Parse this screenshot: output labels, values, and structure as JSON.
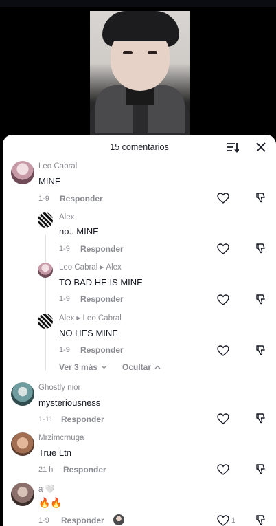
{
  "sheet": {
    "title": "15 comentarios"
  },
  "comments": [
    {
      "user": "Leo Cabral",
      "text": "MINE",
      "date": "1-9",
      "reply_label": "Responder",
      "avatar_color": "#c7a9b4"
    },
    {
      "user": "Alex",
      "text": "no.. MINE",
      "date": "1-9",
      "reply_label": "Responder",
      "avatar_color": "#2a2a2a"
    },
    {
      "user": "Leo Cabral",
      "reply_to": "Alex",
      "text": "TO BAD HE IS MINE",
      "date": "1-9",
      "reply_label": "Responder",
      "avatar_color": "#c7a9b4"
    },
    {
      "user": "Alex",
      "reply_to": "Leo Cabral",
      "text": "NO HES MINE",
      "date": "1-9",
      "reply_label": "Responder",
      "avatar_color": "#2a2a2a"
    },
    {
      "user": "Ghostly nior",
      "text": "mysteriousness",
      "date": "1-11",
      "reply_label": "Responder",
      "avatar_color": "#5f8a8c"
    },
    {
      "user": "Mrzimcrnuga",
      "text": "True Ltn",
      "date": "21 h",
      "reply_label": "Responder",
      "avatar_color": "#b48a70"
    },
    {
      "user": "a 🤍",
      "text": "🔥🔥",
      "date": "1-9",
      "reply_label": "Responder",
      "like_count": "1",
      "avatar_color": "#8a6f6a"
    }
  ],
  "thread": {
    "view_more": "Ver 3 más",
    "hide": "Ocultar"
  },
  "icons": {
    "sort": "sort-icon",
    "close": "close-icon",
    "like": "heart-icon",
    "dislike": "thumbs-down-icon"
  }
}
